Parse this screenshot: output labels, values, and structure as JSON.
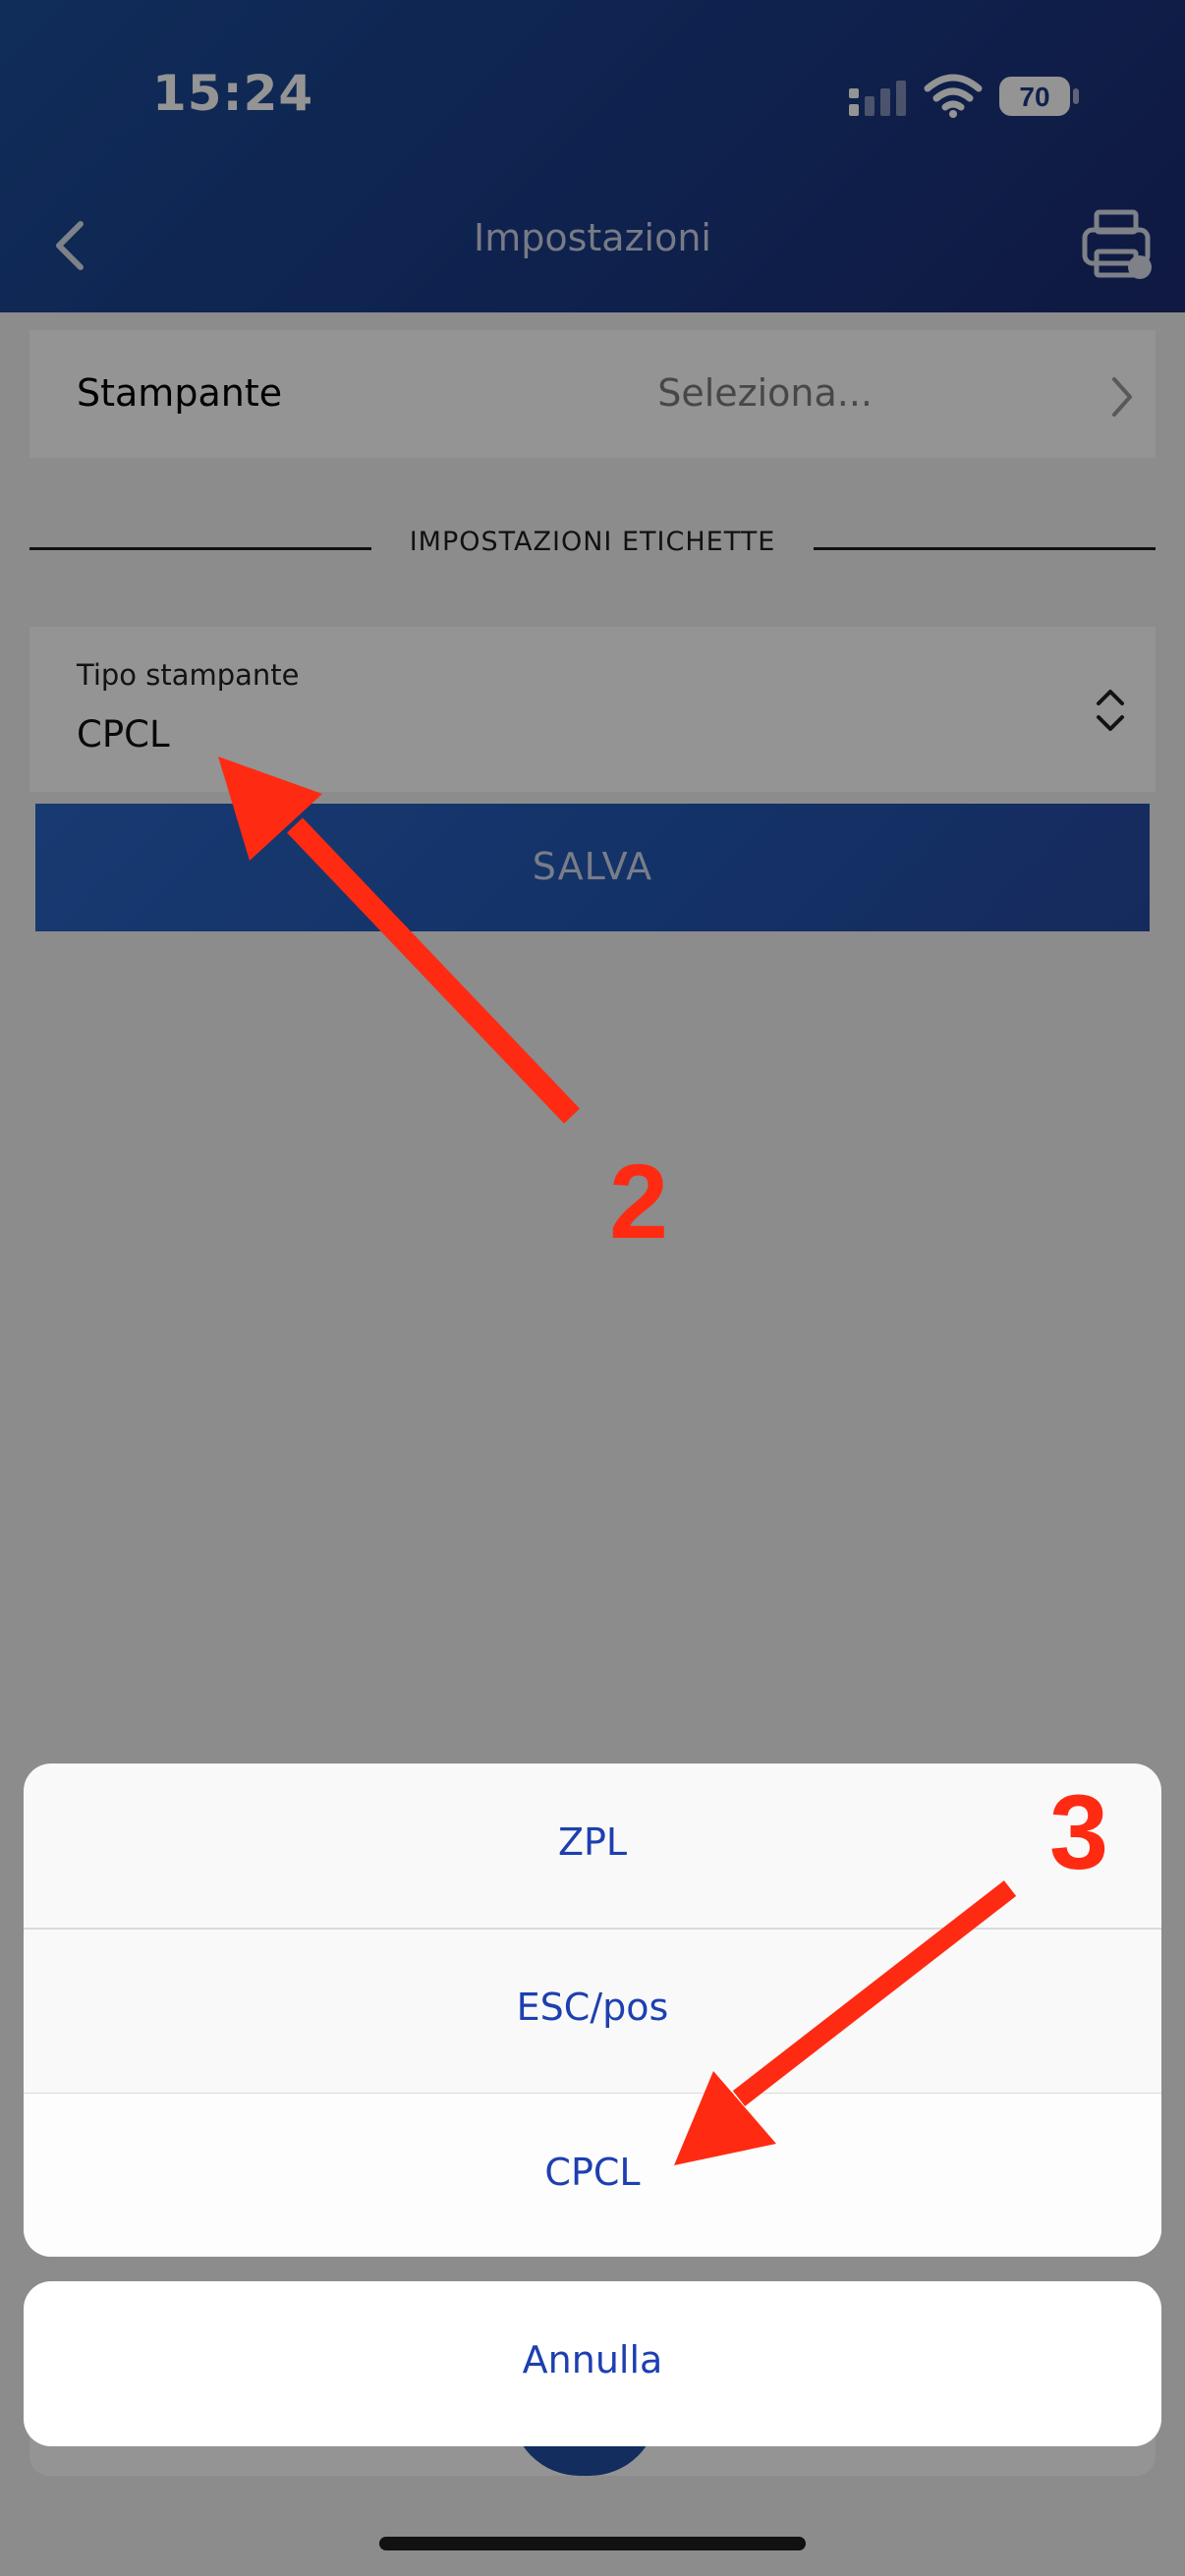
{
  "status_bar": {
    "time": "15:24",
    "battery_level": "70"
  },
  "nav": {
    "title": "Impostazioni",
    "back_icon": "chevron-left-icon",
    "action_icon": "printer-icon"
  },
  "printer_row": {
    "label": "Stampante",
    "value": "Seleziona..."
  },
  "section": {
    "title": "IMPOSTAZIONI ETICHETTE"
  },
  "printer_type": {
    "label": "Tipo stampante",
    "value": "CPCL"
  },
  "save_button": {
    "label": "SALVA"
  },
  "action_sheet": {
    "options": [
      "ZPL",
      "ESC/pos",
      "CPCL"
    ],
    "cancel_label": "Annulla"
  },
  "annotations": {
    "step_two": "2",
    "step_three": "3"
  },
  "colors": {
    "header_blue": "#1a3a86",
    "accent_text": "#1d3fb0",
    "annotation_red": "#ff2a12"
  }
}
